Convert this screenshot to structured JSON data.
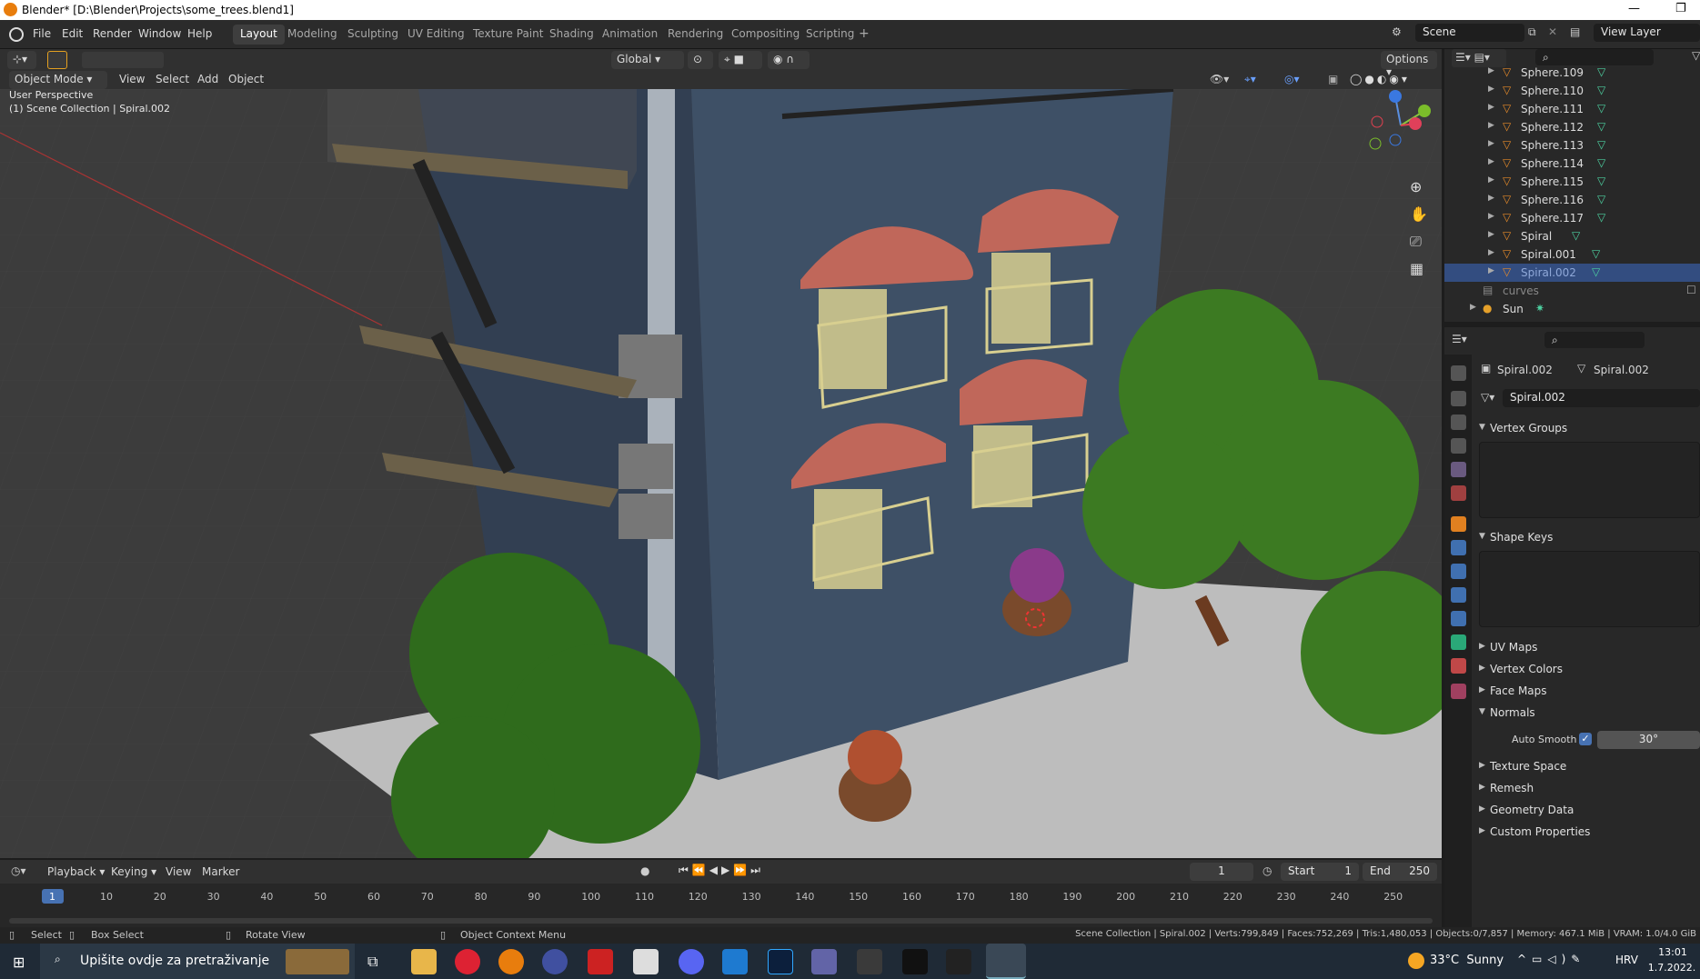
{
  "window": {
    "title": "Blender* [D:\\Blender\\Projects\\some_trees.blend1]"
  },
  "topbar": {
    "menus": [
      "File",
      "Edit",
      "Render",
      "Window",
      "Help"
    ],
    "workspaces": [
      "Layout",
      "Modeling",
      "Sculpting",
      "UV Editing",
      "Texture Paint",
      "Shading",
      "Animation",
      "Rendering",
      "Compositing",
      "Scripting"
    ],
    "active_workspace": "Layout",
    "scene": "Scene",
    "view_layer": "View Layer"
  },
  "viewport_header": {
    "mode": "Object Mode",
    "menus": [
      "View",
      "Select",
      "Add",
      "Object"
    ],
    "transform_orientation": "Global",
    "options": "Options"
  },
  "viewport": {
    "perspective": "User Perspective",
    "collection_info": "(1) Scene Collection | Spiral.002"
  },
  "outliner": {
    "items": [
      "Sphere.109",
      "Sphere.110",
      "Sphere.111",
      "Sphere.112",
      "Sphere.113",
      "Sphere.114",
      "Sphere.115",
      "Sphere.116",
      "Sphere.117",
      "Spiral",
      "Spiral.001",
      "Spiral.002",
      "curves",
      "Sun"
    ],
    "selected": "Spiral.002"
  },
  "properties": {
    "object_name": "Spiral.002",
    "data_name": "Spiral.002",
    "mesh_name": "Spiral.002",
    "sections": [
      "Vertex Groups",
      "Shape Keys",
      "UV Maps",
      "Vertex Colors",
      "Face Maps",
      "Normals",
      "Texture Space",
      "Remesh",
      "Geometry Data",
      "Custom Properties"
    ],
    "auto_smooth_label": "Auto Smooth",
    "auto_smooth_angle": "30°"
  },
  "timeline": {
    "menus": [
      "Playback",
      "Keying",
      "View",
      "Marker"
    ],
    "current_frame": "1",
    "start_label": "Start",
    "start": "1",
    "end_label": "End",
    "end": "250",
    "ticks": [
      "1",
      "10",
      "20",
      "30",
      "40",
      "50",
      "60",
      "70",
      "80",
      "90",
      "100",
      "110",
      "120",
      "130",
      "140",
      "150",
      "160",
      "170",
      "180",
      "190",
      "200",
      "210",
      "220",
      "230",
      "240",
      "250"
    ]
  },
  "statusbar": {
    "select": "Select",
    "box_select": "Box Select",
    "rotate": "Rotate View",
    "context_menu": "Object Context Menu",
    "stats": "Scene Collection | Spiral.002 | Verts:799,849 | Faces:752,269 | Tris:1,480,053 | Objects:0/7,857 | Memory: 467.1 MiB | VRAM: 1.0/4.0 GiB"
  },
  "taskbar": {
    "search_placeholder": "Upišite ovdje za pretraživanje",
    "weather": "33°C  Sunny",
    "lang": "HRV",
    "time": "13:01",
    "date": "1.7.2022."
  }
}
